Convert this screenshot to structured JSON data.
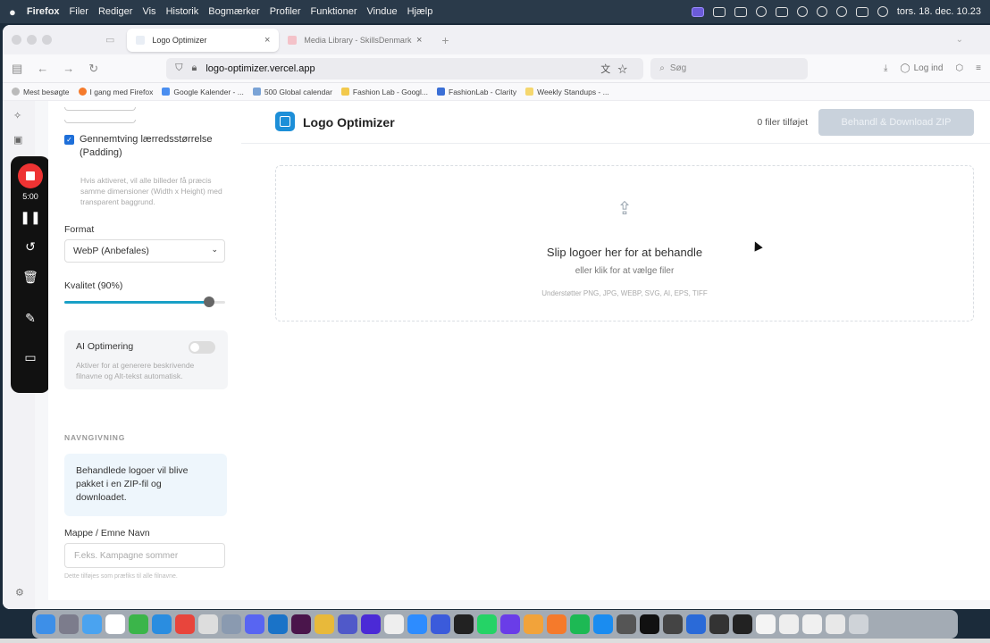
{
  "menubar": {
    "app": "Firefox",
    "items": [
      "Filer",
      "Rediger",
      "Vis",
      "Historik",
      "Bogmærker",
      "Profiler",
      "Funktioner",
      "Vindue",
      "Hjælp"
    ],
    "clock": "tors. 18. dec. 10.23"
  },
  "browser": {
    "tabs": [
      {
        "label": "Logo Optimizer",
        "active": true
      },
      {
        "label": "Media Library - SkillsDenmark",
        "active": false
      }
    ],
    "url": "logo-optimizer.vercel.app",
    "search_placeholder": "Søg",
    "login_label": "Log ind",
    "bookmarks": [
      "Mest besøgte",
      "I gang med Firefox",
      "Google Kalender - ...",
      "500 Global calendar",
      "Fashion Lab - Googl...",
      "FashionLab - Clarity",
      "Weekly Standups - ..."
    ]
  },
  "recorder": {
    "time": "5:00"
  },
  "sidebar": {
    "padding_checkbox_label": "Gennemtving lærredsstørrelse (Padding)",
    "padding_help": "Hvis aktiveret, vil alle billeder få præcis samme dimensioner (Width x Height) med transparent baggrund.",
    "format_label": "Format",
    "format_value": "WebP (Anbefales)",
    "quality_label": "Kvalitet (90%)",
    "quality_value": 0.9,
    "ai_title": "AI Optimering",
    "ai_desc": "Aktiver for at generere beskrivende filnavne og Alt-tekst automatisk.",
    "naming_section": "NAVNGIVNING",
    "naming_info": "Behandlede logoer vil blive pakket i en ZIP-fil og downloadet.",
    "folder_label": "Mappe / Emne Navn",
    "folder_placeholder": "F.eks. Kampagne sommer",
    "folder_hint": "Dette tilføjes som præfiks til alle filnavne."
  },
  "main": {
    "title": "Logo Optimizer",
    "file_count": "0 filer tilføjet",
    "process_button": "Behandl & Download ZIP",
    "drop_title": "Slip logoer her for at behandle",
    "drop_sub": "eller klik for at vælge filer",
    "drop_formats": "Understøtter PNG, JPG, WEBP, SVG, AI, EPS, TIFF"
  },
  "colors": {
    "accent": "#1d8fd8",
    "slider": "#19a0c6",
    "recorder_stop": "#ee3333"
  }
}
